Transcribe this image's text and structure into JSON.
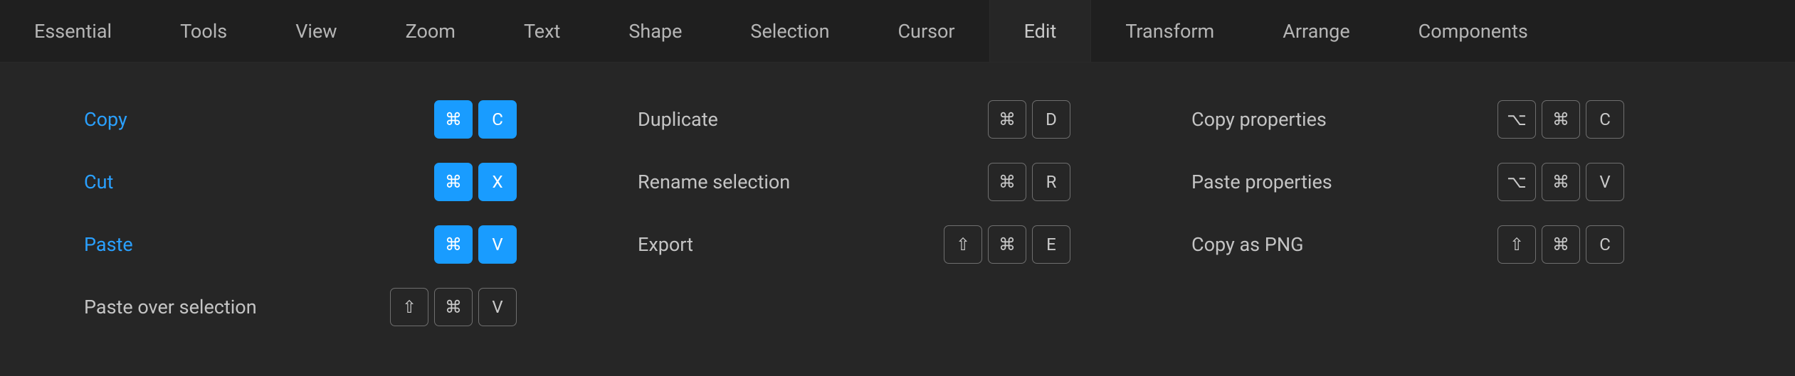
{
  "glyphs": {
    "cmd": "⌘",
    "shift": "⇧",
    "option": "⌥"
  },
  "tabs": [
    {
      "id": "essential",
      "label": "Essential",
      "active": false
    },
    {
      "id": "tools",
      "label": "Tools",
      "active": false
    },
    {
      "id": "view",
      "label": "View",
      "active": false
    },
    {
      "id": "zoom",
      "label": "Zoom",
      "active": false
    },
    {
      "id": "text",
      "label": "Text",
      "active": false
    },
    {
      "id": "shape",
      "label": "Shape",
      "active": false
    },
    {
      "id": "selection",
      "label": "Selection",
      "active": false
    },
    {
      "id": "cursor",
      "label": "Cursor",
      "active": false
    },
    {
      "id": "edit",
      "label": "Edit",
      "active": true
    },
    {
      "id": "transform",
      "label": "Transform",
      "active": false
    },
    {
      "id": "arrange",
      "label": "Arrange",
      "active": false
    },
    {
      "id": "components",
      "label": "Components",
      "active": false
    }
  ],
  "columns": [
    {
      "rows": [
        {
          "id": "copy",
          "label": "Copy",
          "highlight": true,
          "keys": [
            {
              "sym": "cmd"
            },
            {
              "char": "C"
            }
          ]
        },
        {
          "id": "cut",
          "label": "Cut",
          "highlight": true,
          "keys": [
            {
              "sym": "cmd"
            },
            {
              "char": "X"
            }
          ]
        },
        {
          "id": "paste",
          "label": "Paste",
          "highlight": true,
          "keys": [
            {
              "sym": "cmd"
            },
            {
              "char": "V"
            }
          ]
        },
        {
          "id": "paste-over-selection",
          "label": "Paste over selection",
          "highlight": false,
          "keys": [
            {
              "sym": "shift"
            },
            {
              "sym": "cmd"
            },
            {
              "char": "V"
            }
          ]
        }
      ]
    },
    {
      "rows": [
        {
          "id": "duplicate",
          "label": "Duplicate",
          "highlight": false,
          "keys": [
            {
              "sym": "cmd"
            },
            {
              "char": "D"
            }
          ]
        },
        {
          "id": "rename-selection",
          "label": "Rename selection",
          "highlight": false,
          "keys": [
            {
              "sym": "cmd"
            },
            {
              "char": "R"
            }
          ]
        },
        {
          "id": "export",
          "label": "Export",
          "highlight": false,
          "keys": [
            {
              "sym": "shift"
            },
            {
              "sym": "cmd"
            },
            {
              "char": "E"
            }
          ]
        }
      ]
    },
    {
      "rows": [
        {
          "id": "copy-properties",
          "label": "Copy properties",
          "highlight": false,
          "keys": [
            {
              "sym": "option"
            },
            {
              "sym": "cmd"
            },
            {
              "char": "C"
            }
          ]
        },
        {
          "id": "paste-properties",
          "label": "Paste properties",
          "highlight": false,
          "keys": [
            {
              "sym": "option"
            },
            {
              "sym": "cmd"
            },
            {
              "char": "V"
            }
          ]
        },
        {
          "id": "copy-as-png",
          "label": "Copy as PNG",
          "highlight": false,
          "keys": [
            {
              "sym": "shift"
            },
            {
              "sym": "cmd"
            },
            {
              "char": "C"
            }
          ]
        }
      ]
    }
  ]
}
